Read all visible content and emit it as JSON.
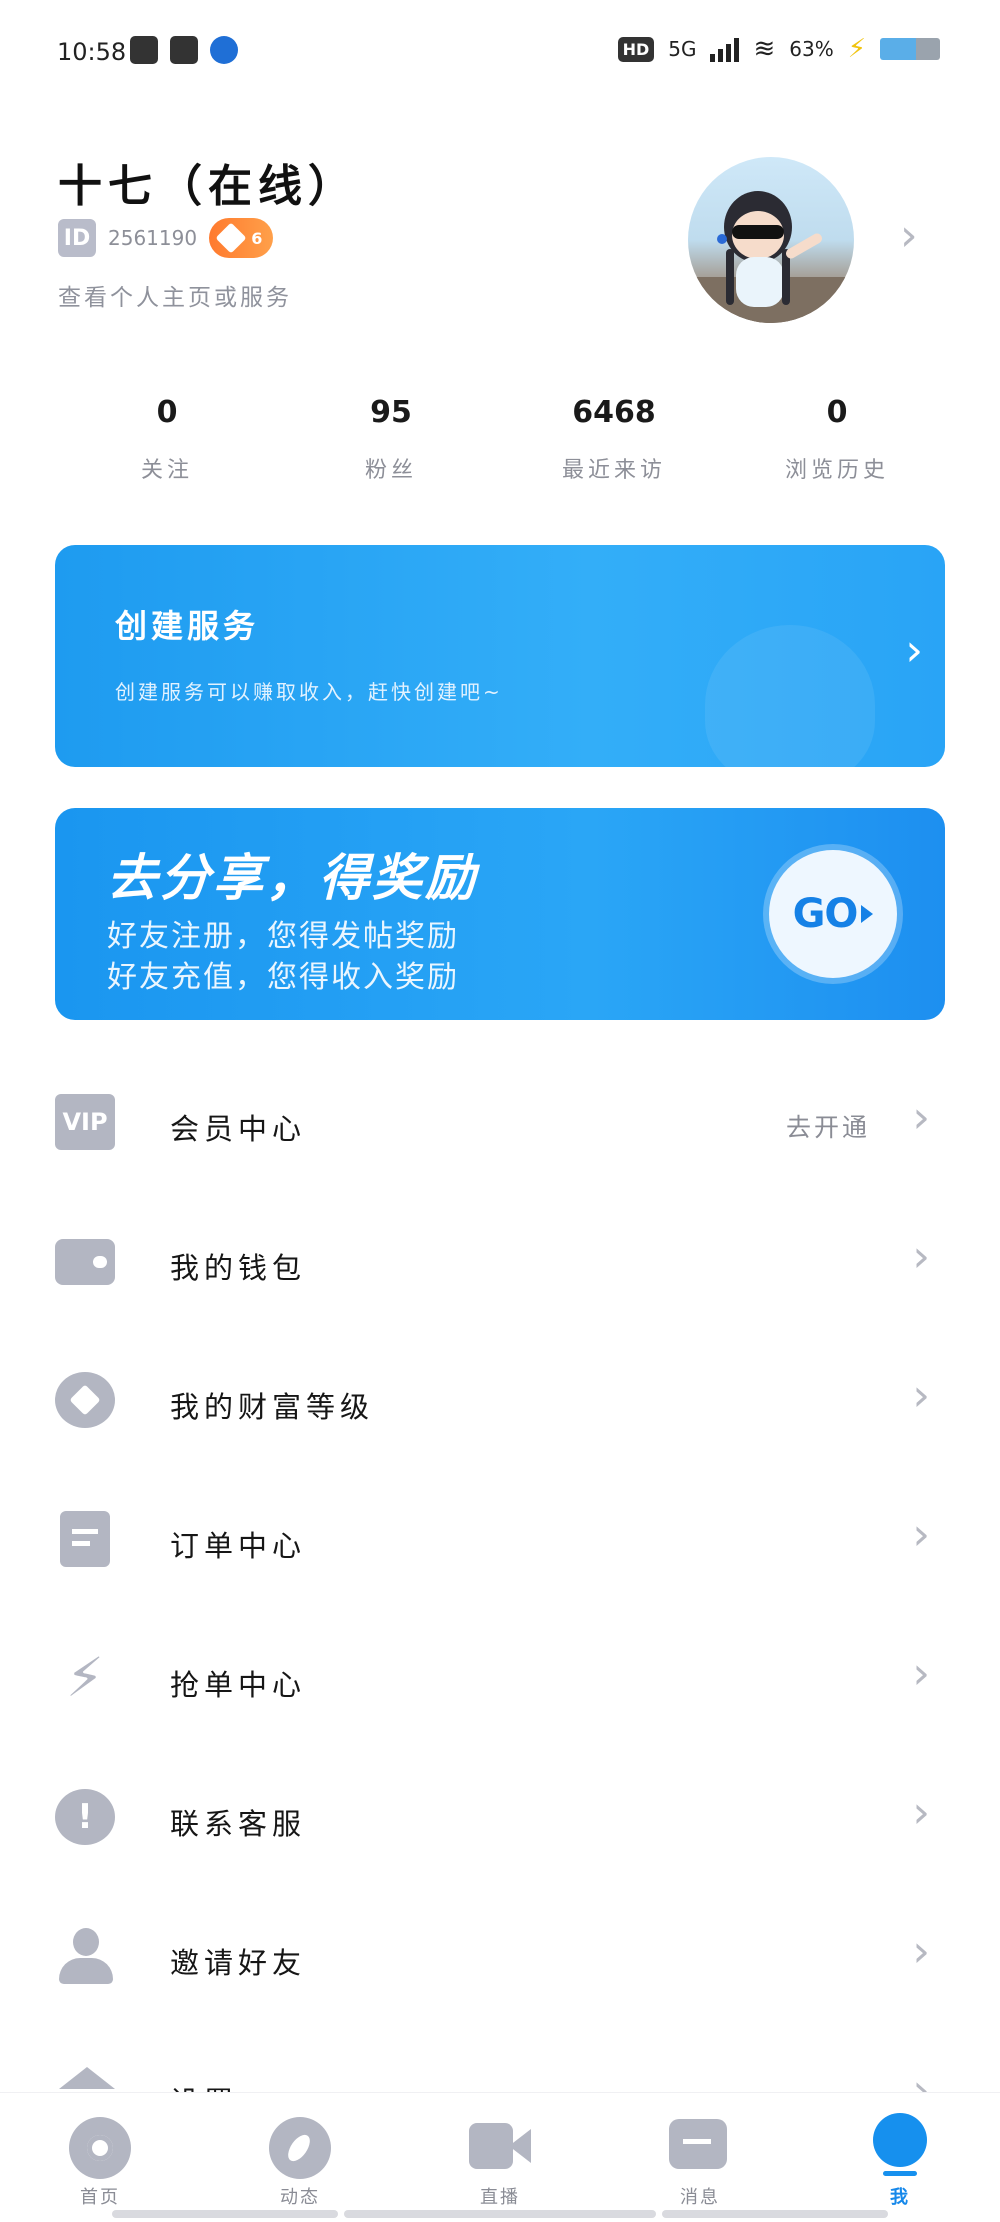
{
  "status_bar": {
    "time": "10:58",
    "network": "5G",
    "battery": "63%",
    "hd_label": "HD"
  },
  "profile": {
    "name": "十七（在线）",
    "id_label": "ID",
    "id_number": "2561190",
    "level": "6",
    "subtitle": "查看个人主页或服务"
  },
  "stats": [
    {
      "value": "0",
      "label": "关注"
    },
    {
      "value": "95",
      "label": "粉丝"
    },
    {
      "value": "6468",
      "label": "最近来访"
    },
    {
      "value": "0",
      "label": "浏览历史"
    }
  ],
  "create_service": {
    "title": "创建服务",
    "description": "创建服务可以赚取收入，赶快创建吧~"
  },
  "share_banner": {
    "title": "去分享，得奖励",
    "line1": "好友注册，您得发帖奖励",
    "line2": "好友充值，您得收入奖励",
    "button": "GO"
  },
  "menu": [
    {
      "icon": "vip-icon",
      "icon_text": "VIP",
      "label": "会员中心",
      "extra": "去开通"
    },
    {
      "icon": "wallet-icon",
      "label": "我的钱包"
    },
    {
      "icon": "diamond-icon",
      "label": "我的财富等级"
    },
    {
      "icon": "order-icon",
      "label": "订单中心"
    },
    {
      "icon": "lightning-icon",
      "label": "抢单中心"
    },
    {
      "icon": "help-icon",
      "icon_text": "!",
      "label": "联系客服"
    },
    {
      "icon": "user-icon",
      "label": "邀请好友"
    },
    {
      "icon": "home-icon",
      "label": "设置"
    }
  ],
  "tabbar": [
    {
      "icon": "home-tab-icon",
      "label": "首页",
      "active": false
    },
    {
      "icon": "compass-icon",
      "label": "动态",
      "active": false
    },
    {
      "icon": "video-icon",
      "label": "直播",
      "active": false
    },
    {
      "icon": "message-icon",
      "label": "消息",
      "active": false
    },
    {
      "icon": "me-icon",
      "label": "我",
      "active": true
    }
  ],
  "colors": {
    "primary_blue": "#1e9bf0",
    "active_tab": "#1688ea",
    "icon_gray": "#b3b6c2",
    "level_orange": "#ff7a2e"
  }
}
